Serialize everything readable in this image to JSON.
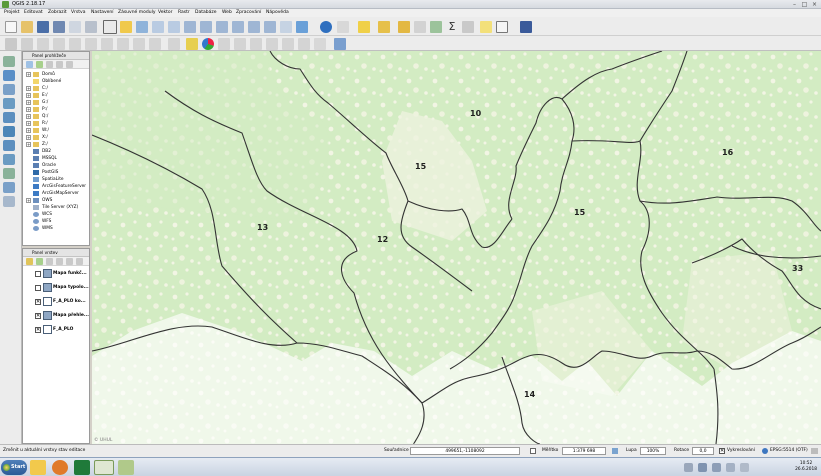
{
  "window": {
    "title": "QGIS 2.18.17"
  },
  "menu": [
    "Projekt",
    "Editovat",
    "Zobrazit",
    "Vrstva",
    "Nastavení",
    "Zásuvné moduly",
    "Vektor",
    "Rastr",
    "Databáze",
    "Web",
    "Zpracování",
    "Nápověda"
  ],
  "browser_panel": {
    "title": "Panel prohlížeče",
    "items": [
      "Domů",
      "Oblíbené",
      "C:/",
      "E:/",
      "G:/",
      "P:/",
      "Q:/",
      "R:/",
      "W:/",
      "X:/",
      "Z:/",
      "DB2",
      "MSSQL",
      "Oracle",
      "PostGIS",
      "SpatiaLite",
      "ArcGisFeatureServer",
      "ArcGisMapServer",
      "OWS",
      "Tile Server (XYZ)",
      "WCS",
      "WFS",
      "WMS"
    ]
  },
  "layers_panel": {
    "title": "Panel vrstev",
    "layers": [
      {
        "name": "Mapa funkč...",
        "checked": false
      },
      {
        "name": "Mapa typolo...",
        "checked": false
      },
      {
        "name": "F_A_PLO ko...",
        "checked": true
      },
      {
        "name": "Mapa přehle...",
        "checked": true
      },
      {
        "name": "F_A_PLO",
        "checked": true
      }
    ]
  },
  "map": {
    "labels": [
      "10",
      "15",
      "16",
      "13",
      "12",
      "15",
      "33",
      "14"
    ],
    "watermark": "© UHUL",
    "colors": {
      "background": "#d3ecc3",
      "light": "#f3f6e6",
      "border": "#333333"
    }
  },
  "statusbar": {
    "message": "Změnit u aktuální vrstvy stav editace",
    "coord_label": "Souřadnice",
    "coord_value": "499651,-1108092",
    "scale_label": "Měřítko",
    "scale_value": "1:379 698",
    "magnifier_label": "Lupa",
    "magnifier_value": "100%",
    "rotation_label": "Rotace",
    "rotation_value": "0,0",
    "render_label": "Vykreslování",
    "crs": "EPSG:5514 (OTF)"
  },
  "taskbar": {
    "start": "Start",
    "time": "10:52",
    "date": "26.6.2018"
  }
}
